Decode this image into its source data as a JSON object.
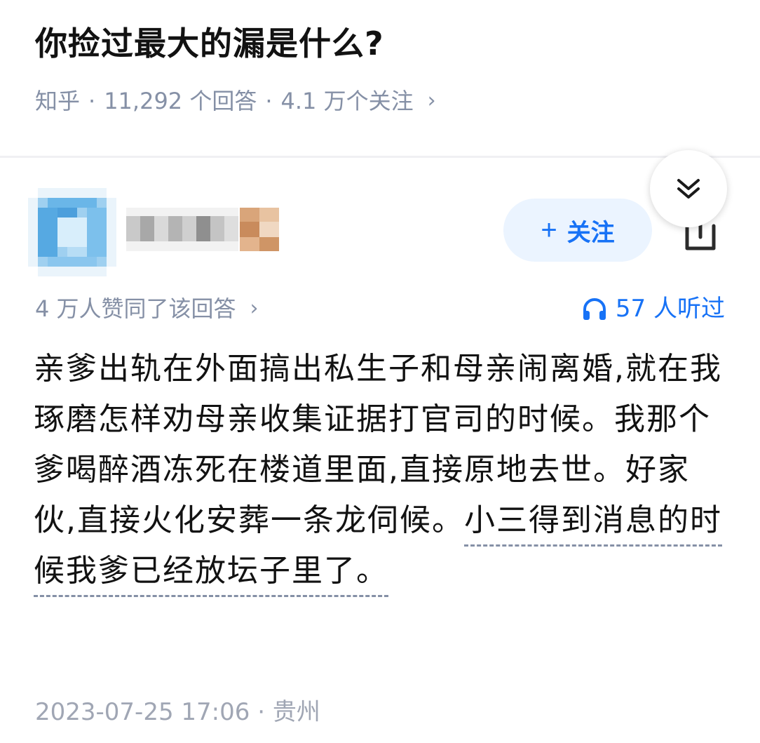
{
  "question": {
    "title": "你捡过最大的漏是什么?",
    "source": "知乎",
    "separator": "·",
    "answers_count": "11,292 个回答",
    "followers": "4.1 万个关注",
    "chevron": "›"
  },
  "answer": {
    "follow_button_label": "关注",
    "follow_plus": "+",
    "upvotes": "4 万人赞同了该回答",
    "listens": "57 人听过",
    "body_plain": "亲爹出轨在外面搞出私生子和母亲闹离婚,就在我琢磨怎样劝母亲收集证据打官司的时候。我那个爹喝醉酒冻死在楼道里面,直接原地去世。好家伙,直接火化安葬一条龙伺候。",
    "body_linked": "小三得到消息的时候我爹已经放坛子里了。",
    "timestamp": "2023-07-25 17:06",
    "location_separator": "·",
    "location": "贵州"
  },
  "colors": {
    "accent_blue": "#1772f6",
    "follow_bg": "#ebf4ff",
    "meta_gray": "#8590a6"
  },
  "icons": {
    "collapse": "double-chevron-down-icon",
    "share": "share-icon",
    "listen": "headphones-icon"
  }
}
